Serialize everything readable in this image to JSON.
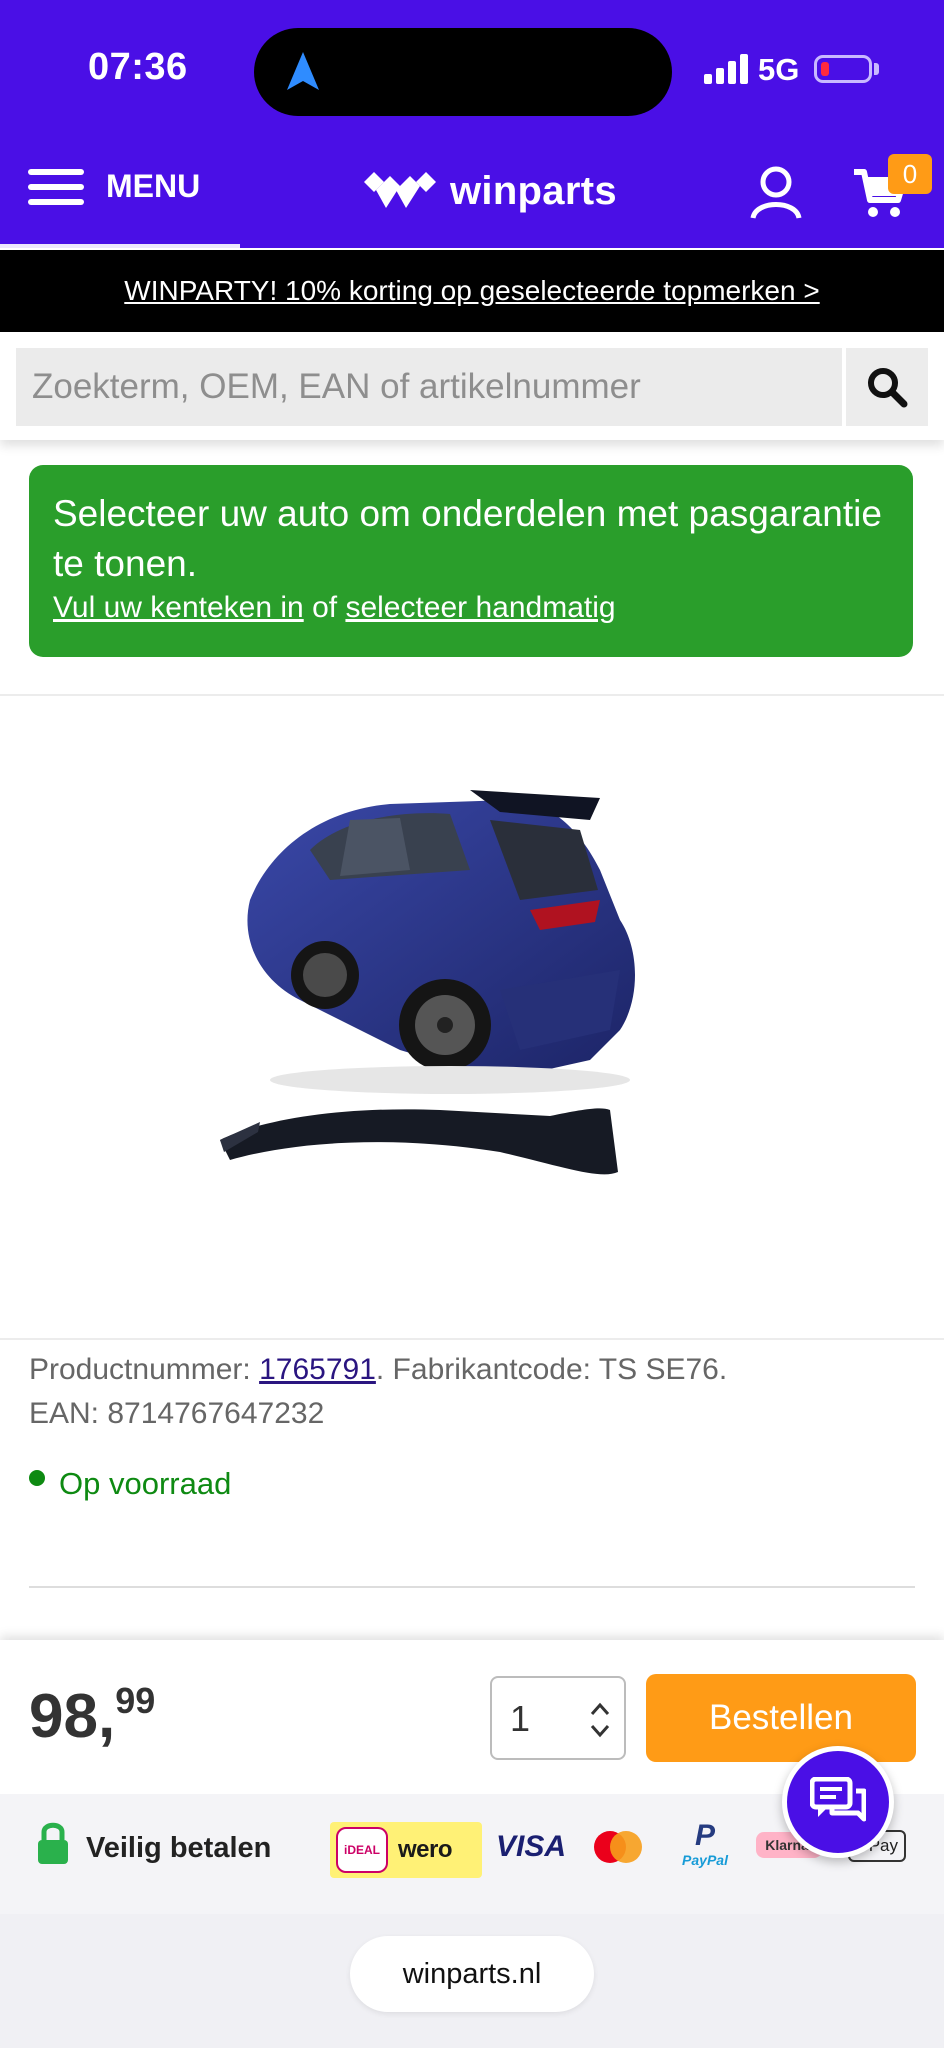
{
  "status_bar": {
    "time": "07:36",
    "network": "5G"
  },
  "header": {
    "menu_label": "MENU",
    "logo_text": "winparts",
    "cart_count": "0",
    "brand_color": "#4a0fe6"
  },
  "promo": {
    "text": "WINPARTY! 10% korting op geselecteerde topmerken >"
  },
  "search": {
    "placeholder": "Zoekterm, OEM, EAN of artikelnummer"
  },
  "vehicle_box": {
    "text": "Selecteer uw auto om onderdelen met pasgarantie te tonen.",
    "link_plate": "Vul uw kenteken in",
    "connector": "of",
    "link_manual": "selecteer handmatig"
  },
  "product": {
    "number_label": "Productnummer:",
    "number": "1765791",
    "maker_code": ". Fabrikantcode: TS SE76.",
    "ean": "EAN: 8714767647232",
    "stock": "Op voorraad"
  },
  "buy_bar": {
    "price_int": "98",
    "price_sep": ",",
    "price_dec": "99",
    "quantity": "1",
    "order_label": "Bestellen"
  },
  "payment": {
    "label": "Veilig betalen",
    "ideal": "iDEAL",
    "wero": "wero",
    "visa": "VISA",
    "paypal": "PayPal",
    "klarna": "Klarna.",
    "applepay": "Pay"
  },
  "browser": {
    "url": "winparts.nl"
  }
}
